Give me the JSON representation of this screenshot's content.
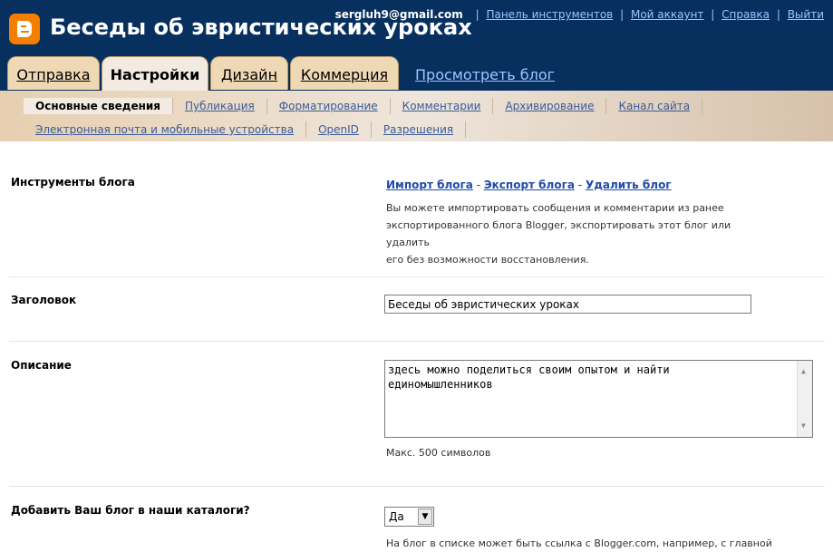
{
  "header": {
    "blog_title": "Беседы об эвристических уроках",
    "email": "sergluh9@gmail.com",
    "links": [
      "Панель инструментов",
      "Мой аккаунт",
      "Справка",
      "Выйти"
    ]
  },
  "tabs": [
    "Отправка",
    "Настройки",
    "Дизайн",
    "Коммерция"
  ],
  "view_blog": "Просмотреть блог",
  "subtabs_row1": [
    "Основные сведения",
    "Публикация",
    "Форматирование",
    "Комментарии",
    "Архивирование",
    "Канал сайта"
  ],
  "subtabs_row2": [
    "Электронная почта и мобильные устройства",
    "OpenID",
    "Разрешения"
  ],
  "tools": {
    "label": "Инструменты блога",
    "import": "Импорт блога",
    "export": "Экспорт блога",
    "delete": "Удалить блог",
    "dash": " - ",
    "desc_lines": [
      "Вы можете импортировать сообщения и комментарии из ранее",
      "экспортированного блога Blogger, экспортировать этот блог или удалить",
      "его без возможности восстановления."
    ]
  },
  "title_field": {
    "label": "Заголовок",
    "value": "Беседы об эвристических уроках"
  },
  "description_field": {
    "label": "Описание",
    "value_lines": [
      "здесь можно поделиться своим опытом и найти",
      "единомышленников"
    ],
    "hint": "Макс. 500 символов"
  },
  "catalog": {
    "label": "Добавить Ваш блог в наши каталоги?",
    "selected": "Да",
    "hint": "На блог в списке может быть ссылка с Blogger.com, например, с главной"
  },
  "colors": {
    "header_bg": "#07305f",
    "logo": "#f57d00",
    "link": "#1f4aa8"
  }
}
